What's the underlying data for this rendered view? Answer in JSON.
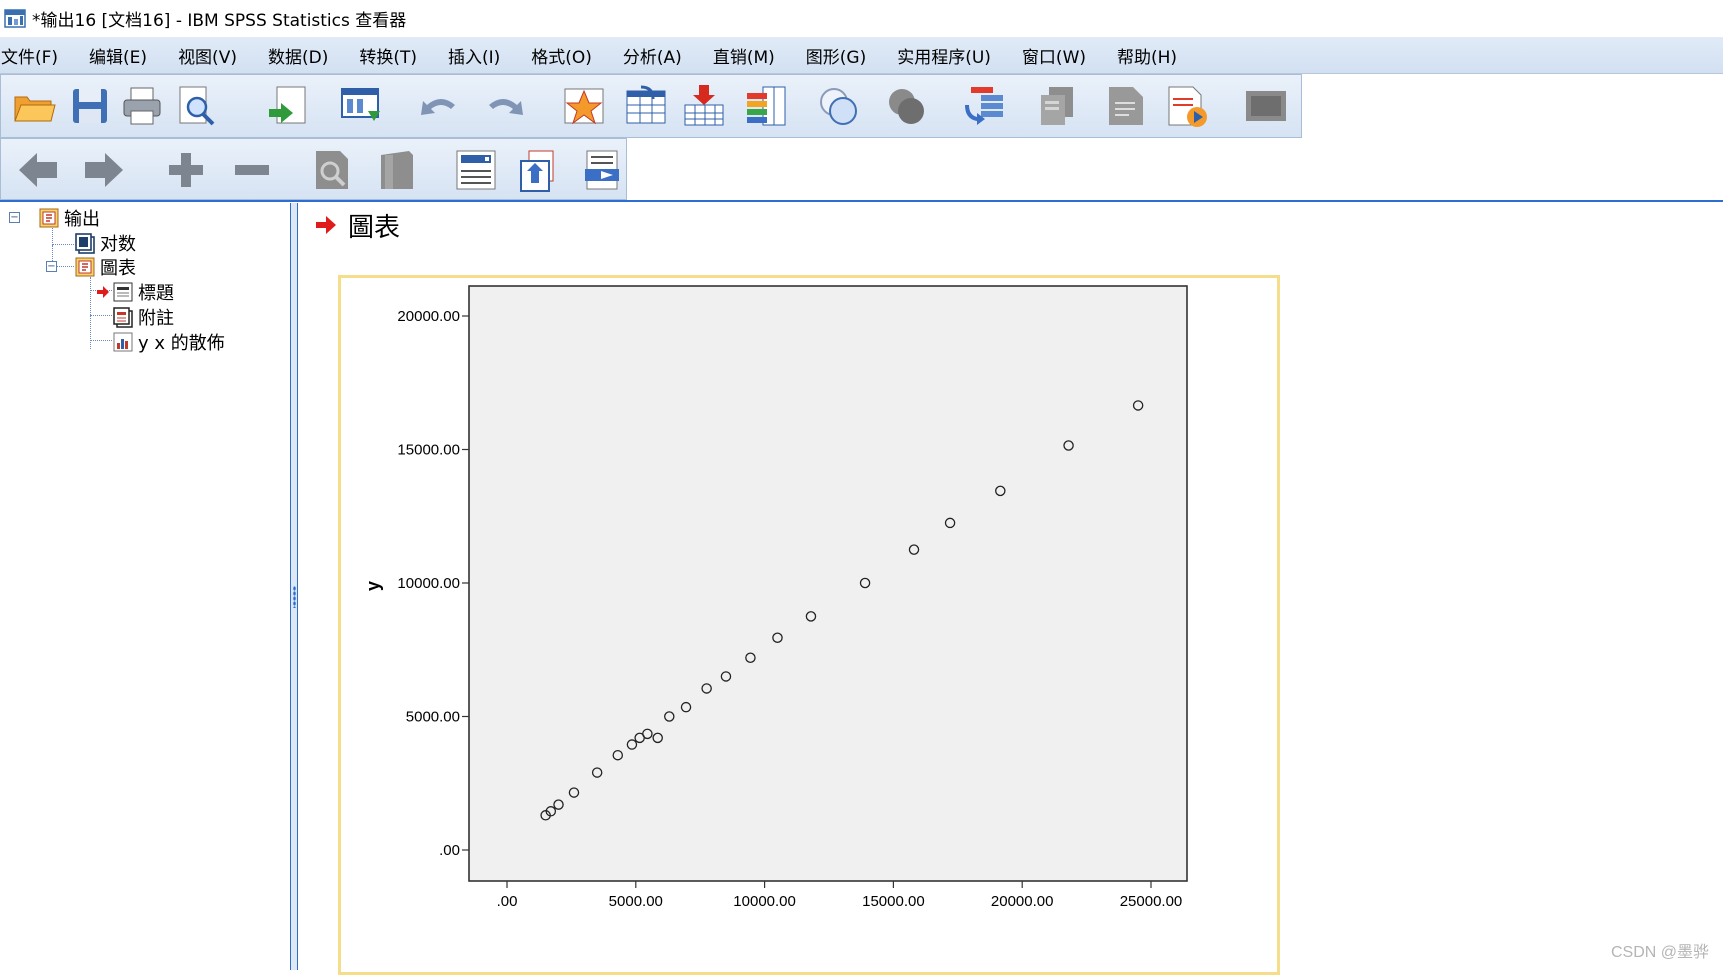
{
  "window": {
    "title": "*输出16 [文档16] - IBM SPSS Statistics 查看器"
  },
  "menu": [
    {
      "label": "文件(F)"
    },
    {
      "label": "编辑(E)"
    },
    {
      "label": "视图(V)"
    },
    {
      "label": "数据(D)"
    },
    {
      "label": "转换(T)"
    },
    {
      "label": "插入(I)"
    },
    {
      "label": "格式(O)"
    },
    {
      "label": "分析(A)"
    },
    {
      "label": "直销(M)"
    },
    {
      "label": "图形(G)"
    },
    {
      "label": "实用程序(U)"
    },
    {
      "label": "窗口(W)"
    },
    {
      "label": "帮助(H)"
    }
  ],
  "toolbar1": [
    {
      "icon": "open-folder-icon"
    },
    {
      "icon": "save-icon"
    },
    {
      "icon": "print-icon"
    },
    {
      "icon": "print-preview-icon"
    },
    {
      "icon": "export-icon"
    },
    {
      "icon": "recall-dialog-icon"
    },
    {
      "icon": "undo-icon"
    },
    {
      "icon": "redo-icon"
    },
    {
      "icon": "goto-data-icon"
    },
    {
      "icon": "goto-case-icon"
    },
    {
      "icon": "insert-cases-icon"
    },
    {
      "icon": "variables-icon"
    },
    {
      "icon": "split-file-icon"
    },
    {
      "icon": "weight-cases-icon"
    },
    {
      "icon": "select-cases-icon"
    },
    {
      "icon": "designate-window-icon"
    },
    {
      "icon": "insert-text-icon"
    },
    {
      "icon": "run-script-icon"
    },
    {
      "icon": "show-all-icon"
    }
  ],
  "toolbar2": [
    {
      "icon": "back-arrow-icon"
    },
    {
      "icon": "forward-arrow-icon"
    },
    {
      "icon": "expand-plus-icon"
    },
    {
      "icon": "collapse-minus-icon"
    },
    {
      "icon": "show-icon"
    },
    {
      "icon": "hide-icon"
    },
    {
      "icon": "insert-heading-icon"
    },
    {
      "icon": "insert-title-icon"
    },
    {
      "icon": "insert-page-break-icon"
    }
  ],
  "outline": {
    "root": "输出",
    "log": "对数",
    "graph": "圖表",
    "title": "標題",
    "notes": "附註",
    "scatter": "y x 的散佈"
  },
  "content": {
    "heading": "圖表"
  },
  "chart_data": {
    "type": "scatter",
    "title": "",
    "xlabel": "",
    "ylabel": "y",
    "xlim": [
      0,
      25000
    ],
    "ylim": [
      0,
      20000
    ],
    "x_ticks": [
      ".00",
      "5000.00",
      "10000.00",
      "15000.00",
      "20000.00",
      "25000.00"
    ],
    "y_ticks": [
      ".00",
      "5000.00",
      "10000.00",
      "15000.00",
      "20000.00"
    ],
    "grid": false,
    "marker": "hollow circle",
    "points": [
      {
        "x": 1500,
        "y": 1300
      },
      {
        "x": 1700,
        "y": 1450
      },
      {
        "x": 2000,
        "y": 1700
      },
      {
        "x": 2600,
        "y": 2150
      },
      {
        "x": 3500,
        "y": 2900
      },
      {
        "x": 4300,
        "y": 3550
      },
      {
        "x": 4850,
        "y": 3950
      },
      {
        "x": 5150,
        "y": 4200
      },
      {
        "x": 5450,
        "y": 4350
      },
      {
        "x": 5850,
        "y": 4200
      },
      {
        "x": 6300,
        "y": 5000
      },
      {
        "x": 6950,
        "y": 5350
      },
      {
        "x": 7750,
        "y": 6050
      },
      {
        "x": 8500,
        "y": 6500
      },
      {
        "x": 9450,
        "y": 7200
      },
      {
        "x": 10500,
        "y": 7950
      },
      {
        "x": 11800,
        "y": 8750
      },
      {
        "x": 13900,
        "y": 10000
      },
      {
        "x": 15800,
        "y": 11250
      },
      {
        "x": 17200,
        "y": 12250
      },
      {
        "x": 19150,
        "y": 13450
      },
      {
        "x": 21800,
        "y": 15150
      },
      {
        "x": 24500,
        "y": 16650
      }
    ]
  },
  "watermark": "CSDN @墨骅"
}
